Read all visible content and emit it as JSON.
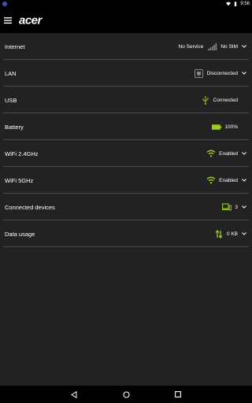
{
  "status_bar": {
    "time": "9:56",
    "icons": [
      "app-notification-icon",
      "wifi-icon",
      "battery-icon"
    ]
  },
  "app_bar": {
    "logo_text": "acer",
    "menu_icon": "hamburger-menu-icon"
  },
  "rows": [
    {
      "label": "Internet",
      "extra": "No Service",
      "value": "No SIM",
      "icon": "signal-bars-icon",
      "expandable": true
    },
    {
      "label": "LAN",
      "value": "Disconnected",
      "icon": "ethernet-icon",
      "expandable": true
    },
    {
      "label": "USB",
      "value": "Connected",
      "icon": "usb-icon",
      "expandable": false
    },
    {
      "label": "Battery",
      "value": "100%",
      "icon": "battery-full-icon",
      "expandable": false
    },
    {
      "label": "WiFi 2.4GHz",
      "value": "Enabled",
      "icon": "wifi-icon",
      "expandable": true
    },
    {
      "label": "WiFi 5GHz",
      "value": "Enabled",
      "icon": "wifi-icon",
      "expandable": true
    },
    {
      "label": "Connected devices",
      "value": "3",
      "icon": "devices-icon",
      "expandable": true
    },
    {
      "label": "Data usage",
      "value": "0 KB",
      "icon": "data-transfer-icon",
      "expandable": true
    }
  ],
  "nav_bar": {
    "icons": [
      "back-icon",
      "home-icon",
      "recents-icon"
    ]
  },
  "colors": {
    "background": "#222222",
    "bar": "#000000",
    "accent_green": "#9ccc1f",
    "divider": "#4a4a4a"
  }
}
